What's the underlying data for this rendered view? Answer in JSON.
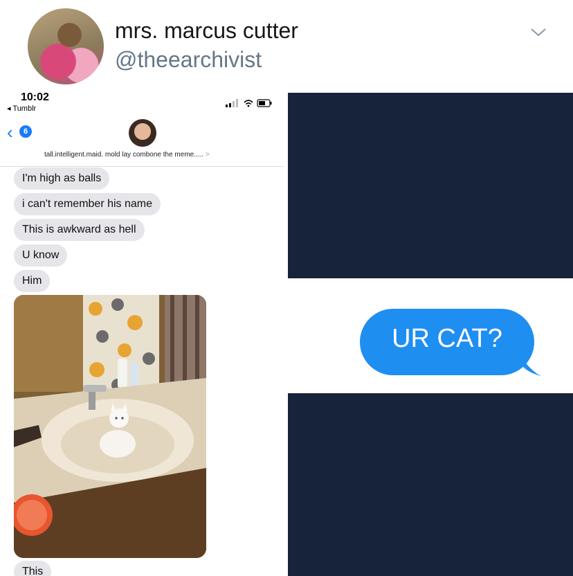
{
  "header": {
    "display_name": "mrs. marcus cutter",
    "handle": "@theearchivist"
  },
  "phone": {
    "status_bar": {
      "time": "10:02",
      "back_app": "◂ Tumblr"
    },
    "nav": {
      "back_badge": "6",
      "contact_name": "tall.intelligent.maid. mold lay combone the meme.....",
      "contact_arrow": ">"
    },
    "messages": [
      "I'm high as balls",
      "i can't remember his name",
      "This is awkward as hell",
      "U know",
      "Him",
      "This"
    ]
  },
  "reply": {
    "text": "UR CAT?",
    "color": "#1f8ef1"
  },
  "colors": {
    "navy_panel": "#17223b",
    "incoming_bubble": "#e5e5ea",
    "ios_blue": "#1a7cf5"
  },
  "icons": [
    "chevron-down-icon",
    "cellular-signal-icon",
    "wifi-icon",
    "battery-icon",
    "back-chevron-icon"
  ]
}
